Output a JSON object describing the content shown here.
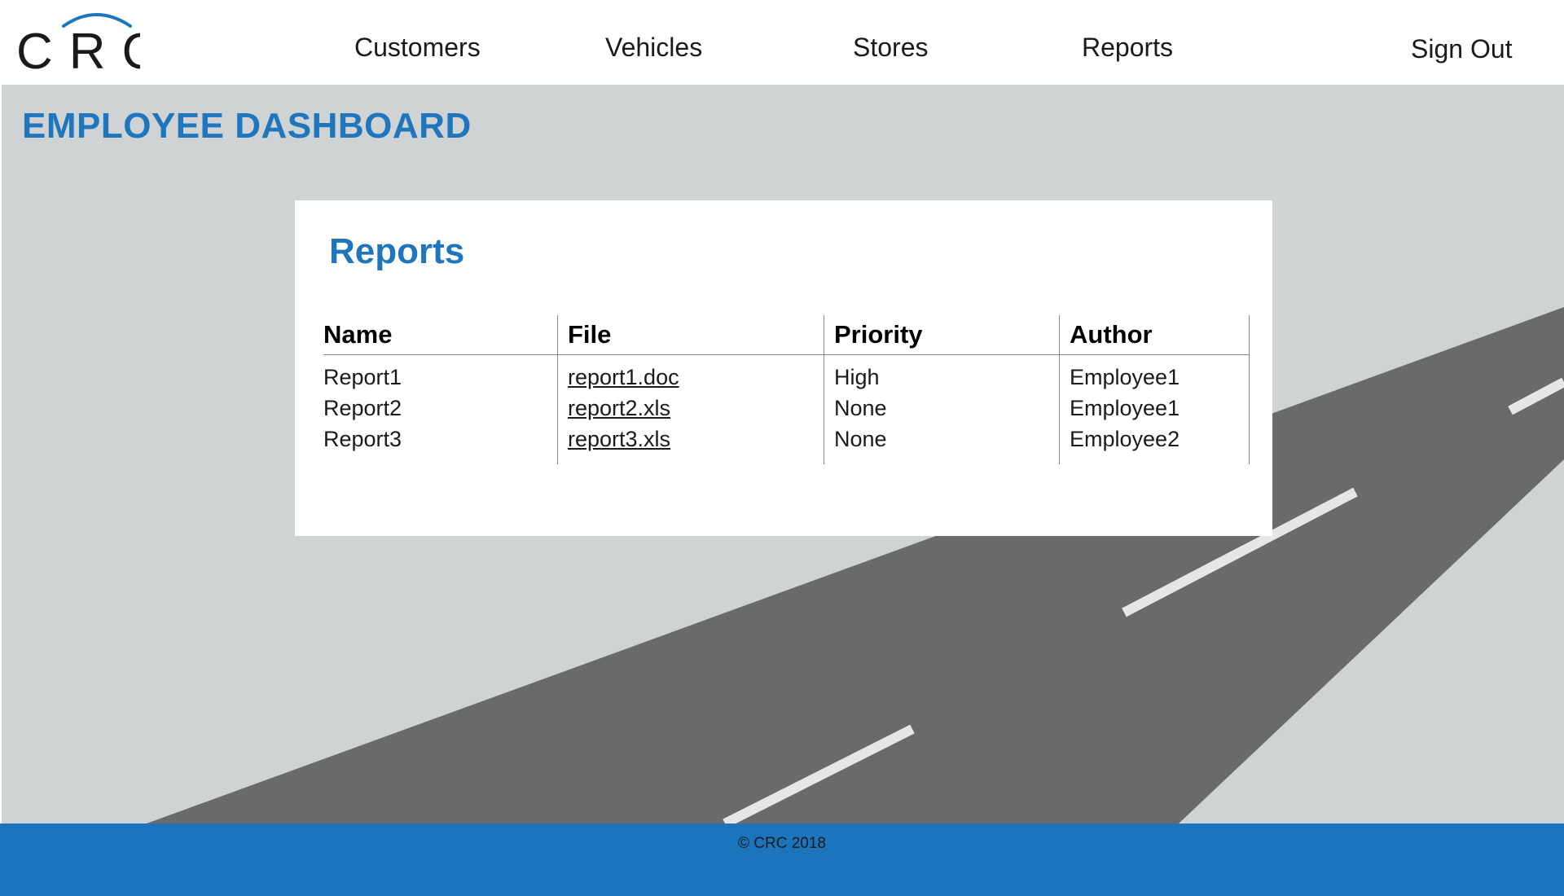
{
  "brand": {
    "logo_text": "CRC",
    "accent_color": "#1f76bd"
  },
  "nav": {
    "items": [
      {
        "label": "Customers"
      },
      {
        "label": "Vehicles"
      },
      {
        "label": "Stores"
      },
      {
        "label": "Reports"
      }
    ],
    "sign_out_label": "Sign Out"
  },
  "page": {
    "title": "EMPLOYEE DASHBOARD"
  },
  "reports_panel": {
    "title": "Reports",
    "columns": [
      "Name",
      "File",
      "Priority",
      "Author"
    ],
    "rows": [
      {
        "name": "Report1",
        "file": "report1.doc",
        "priority": "High",
        "author": "Employee1"
      },
      {
        "name": "Report2",
        "file": "report2.xls",
        "priority": "None",
        "author": "Employee1"
      },
      {
        "name": "Report3",
        "file": "report3.xls",
        "priority": "None",
        "author": "Employee2"
      }
    ]
  },
  "footer": {
    "copyright": "© CRC 2018",
    "background_color": "#1c75bc"
  },
  "background": {
    "main_color": "#d0d3d4",
    "road_color": "#6a6a6a",
    "road_line_color": "#e6e6e6"
  }
}
